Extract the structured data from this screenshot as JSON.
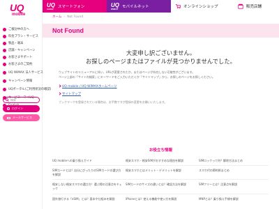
{
  "header": {
    "logo": "UQ",
    "logo_sub": "mobile",
    "tabs": [
      {
        "badge": "UQ",
        "badge_sub": "mobile",
        "label": "スマートフォン"
      },
      {
        "badge": "UQ",
        "badge_sub": "WiMAX",
        "label": "モバイルネット"
      },
      {
        "label": "オンラインショップ"
      },
      {
        "label": "販売店舗"
      }
    ]
  },
  "breadcrumb": {
    "home": "ホーム",
    "sep": "›",
    "current": "Not Found"
  },
  "sidebar": {
    "items": [
      "ご検討中の方へ",
      "料金プラン・サービス",
      "製品・端末",
      "店舗・キャンペーン",
      "お客さまサポート",
      "お客さまのご契約",
      "UQ WiMAX 法人サービス",
      "キャンペーン情報",
      "UQポータル(ご利用状況の確認)",
      "サービス・マイUQ",
      "English"
    ],
    "search_placeholder": "検索",
    "btn1": "ログイン",
    "btn2": "メールサービス"
  },
  "main": {
    "title": "Not Found",
    "message_line1": "大変申し訳ございません。",
    "message_line2": "お探しのページまたはファイルが見つかりませんでした。",
    "body_line1": "ウェブサイトのリニューアルに伴い、URLが変更されたか、またはページが存在しない可能性がございます。",
    "body_line2": "ページ上部の「サイト内検索」にキーワードをご入力いただくか「サイトマップ」から、お探しのページをお探しください。",
    "link1": "UQ mobile / UQ WiMAXホームページ",
    "link2": "サイトマップ",
    "bookmark": "ブックマークを登録されている場合は、お手数ですが登録の変更をお願いいたします。"
  },
  "info": {
    "title": "お役立ち情報",
    "col1": [
      "UQ mobileへの乗り換えガイド",
      "SIMカードとは？自分にぴったりのSIMカードの選び方を解説",
      "格安しない格安スマホの選び方！選ぶ際の注意点をチェック",
      "国外旅行する「eSIM」とは？基本や仕組みを解説"
    ],
    "col2": [
      "格安スマホ・格安SIMがおすすめな理由を解説",
      "格安スマホとはメリット・デメリットを解説",
      "SIMカードのサイズの違いとは？確認方法を解説",
      "iPhoneとは？使える機能や使い方を解説"
    ],
    "col3": [
      "SIMロックって何？解除方法まとめ",
      "スマホ代の節約術まとめ",
      "SIMフリーとは？注意点を解説",
      "MNPとは？乗り換え手順を解説"
    ]
  }
}
